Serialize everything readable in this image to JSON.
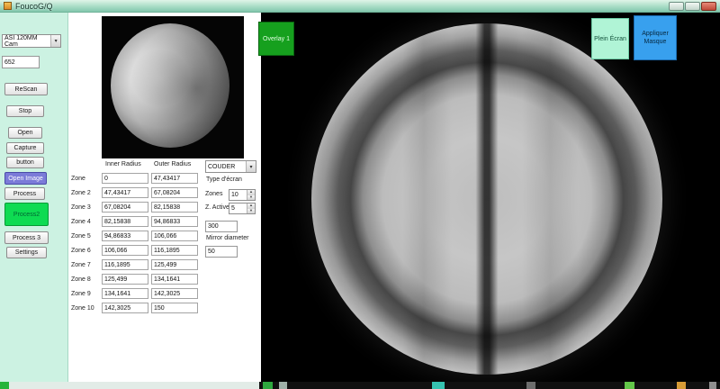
{
  "window": {
    "title": "FoucoG/Q"
  },
  "left_panel": {
    "camera_select": "ASI 120MM Cam",
    "value_field": "652",
    "buttons": [
      {
        "label": "ReScan"
      },
      {
        "label": "Stop"
      },
      {
        "label": "Open"
      },
      {
        "label": "Capture"
      },
      {
        "label": "button"
      },
      {
        "label": "Open Image"
      },
      {
        "label": "Process"
      },
      {
        "label": "Process2"
      },
      {
        "label": "Process 3"
      },
      {
        "label": "Settings"
      }
    ]
  },
  "zones_table": {
    "headers": {
      "inner": "Inner Radius",
      "outer": "Outer Radius"
    },
    "rows": [
      {
        "zone": "Zone",
        "inner": "0",
        "outer": "47,43417"
      },
      {
        "zone": "Zone 2",
        "inner": "47,43417",
        "outer": "67,08204"
      },
      {
        "zone": "Zone 3",
        "inner": "67,08204",
        "outer": "82,15838"
      },
      {
        "zone": "Zone 4",
        "inner": "82,15838",
        "outer": "94,86833"
      },
      {
        "zone": "Zone 5",
        "inner": "94,86833",
        "outer": "106,066"
      },
      {
        "zone": "Zone 6",
        "inner": "106,066",
        "outer": "116,1895"
      },
      {
        "zone": "Zone 7",
        "inner": "116,1895",
        "outer": "125,499"
      },
      {
        "zone": "Zone 8",
        "inner": "125,499",
        "outer": "134,1641"
      },
      {
        "zone": "Zone 9",
        "inner": "134,1641",
        "outer": "142,3025"
      },
      {
        "zone": "Zone 10",
        "inner": "142,3025",
        "outer": "150"
      }
    ]
  },
  "mask_panel": {
    "screen_type": "COUDER",
    "screen_type_label": "Type d'écran",
    "zones_label": "Zones",
    "zones_value": "10",
    "active_label": "Z. Active",
    "active_value": "5",
    "diameter_value": "300",
    "diameter_label": "Mirror diameter",
    "offset_value": "50"
  },
  "image_buttons": {
    "overlay": "Overlay 1",
    "fullscreen": "Plein Écran",
    "apply_mask": "Appliquer Masque"
  },
  "colors": {
    "panel_mint": "#ccf2e2",
    "accent_green": "#0edb52",
    "accent_blue": "#38a0ee",
    "accent_mint_button": "#b0f4d6",
    "highlight_purple": "#7b7bd8",
    "titlebar_teal": "#a8dcc6"
  }
}
